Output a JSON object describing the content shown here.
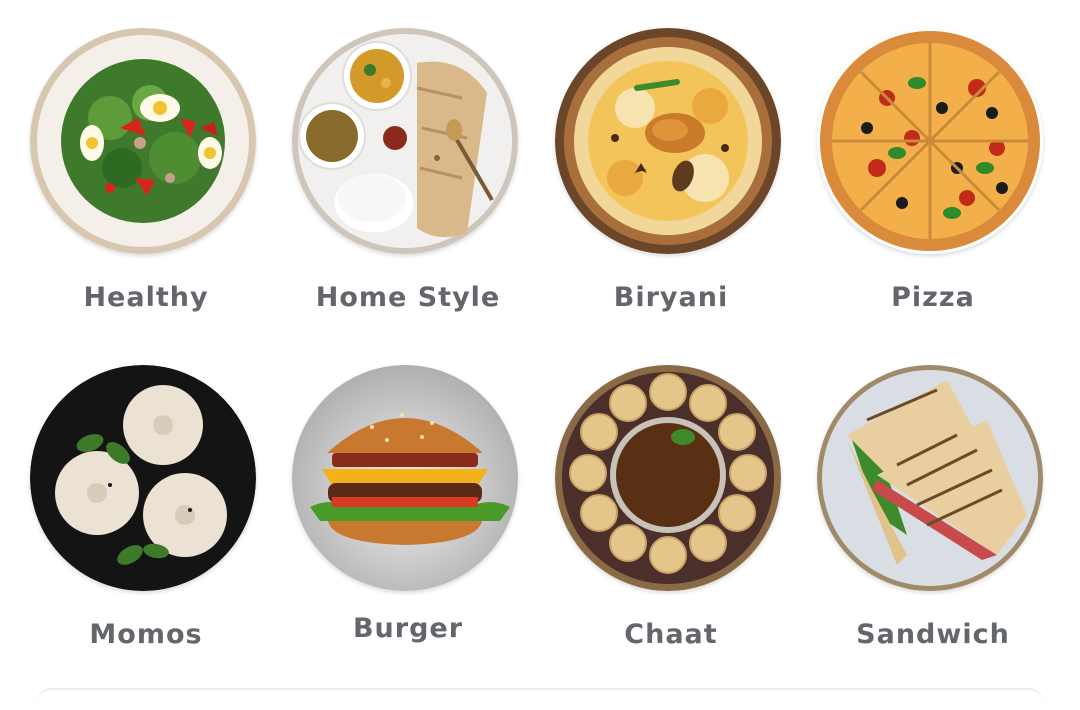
{
  "categories": [
    {
      "label": "Healthy",
      "icon": "salad-plate-icon"
    },
    {
      "label": "Home Style",
      "icon": "thali-plate-icon"
    },
    {
      "label": "Biryani",
      "icon": "biryani-bowl-icon"
    },
    {
      "label": "Pizza",
      "icon": "pizza-icon"
    },
    {
      "label": "Momos",
      "icon": "momos-plate-icon"
    },
    {
      "label": "Burger",
      "icon": "burger-icon"
    },
    {
      "label": "Chaat",
      "icon": "chaat-plate-icon"
    },
    {
      "label": "Sandwich",
      "icon": "sandwich-plate-icon"
    }
  ],
  "colors": {
    "label_text": "#63666b",
    "background": "#ffffff"
  }
}
